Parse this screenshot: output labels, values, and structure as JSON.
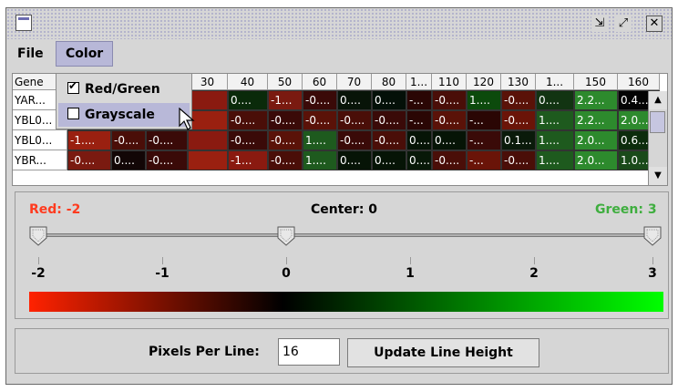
{
  "window": {
    "restore_icon": "restore-icon",
    "maximize_icon": "maximize-icon",
    "close_icon": "close-icon"
  },
  "menubar": {
    "file": "File",
    "color": "Color"
  },
  "color_menu": {
    "items": [
      {
        "label": "Red/Green",
        "checked": true
      },
      {
        "label": "Grayscale",
        "checked": false
      }
    ]
  },
  "table": {
    "first_header": "Gene",
    "columns": [
      "30",
      "40",
      "50",
      "60",
      "70",
      "80",
      "1...",
      "110",
      "120",
      "130",
      "1...",
      "150",
      "160"
    ],
    "rows": [
      {
        "label": "YAR...",
        "cells": [
          "",
          "0....",
          "-1...",
          "-0....",
          "0....",
          "0....",
          "-...",
          "-0....",
          "1....",
          "-0....",
          "0....",
          "2.2...",
          "0.4..."
        ],
        "colors": [
          "#8a1a10",
          "#0a2a0a",
          "#7a1a10",
          "#3a0a08",
          "#081408",
          "#041008",
          "#2a0604",
          "#4a0e08",
          "#0c4a0c",
          "#5a1208",
          "#123412",
          "#2d8a2d",
          "#040404"
        ]
      },
      {
        "label": "YBL0...",
        "cells": [
          "",
          "-0....",
          "-0....",
          "-0....",
          "-0....",
          "-0....",
          "-...",
          "-0....",
          "-...",
          "-0....",
          "1....",
          "2.2...",
          "2.0..."
        ],
        "colors": [
          "#9a2010",
          "#4a0e08",
          "#3a0a08",
          "#5a1208",
          "#4a0e08",
          "#3a0a08",
          "#2a0604",
          "#5a1208",
          "#2a0604",
          "#6a1408",
          "#1e5a1e",
          "#2d8a2d",
          "#2d8a2d"
        ]
      },
      {
        "label": "YBL0...",
        "cells": [
          "",
          "-0....",
          "-0....",
          "1....",
          "-0....",
          "-0....",
          "0....",
          "0....",
          "-...",
          "0.1...",
          "1....",
          "2.0...",
          "0.6..."
        ],
        "colors": [
          "#8a1a10",
          "#3a0a08",
          "#5a1208",
          "#1e5a1e",
          "#3a0a08",
          "#4a0e08",
          "#061406",
          "#061406",
          "#3a0a08",
          "#0a1a0a",
          "#1e5a1e",
          "#2d8a2d",
          "#0c2c0c"
        ]
      },
      {
        "label": "YBR...",
        "cells": [
          "",
          "-1...",
          "-0....",
          "1....",
          "0....",
          "0....",
          "0....",
          "-0....",
          "-...",
          "-0....",
          "1....",
          "2.0...",
          "1.0..."
        ],
        "colors": [
          "#9a2010",
          "#8a1a10",
          "#4a0e08",
          "#1e5a1e",
          "#061406",
          "#061406",
          "#081808",
          "#4a0e08",
          "#6a1408",
          "#4a0e08",
          "#1e5a1e",
          "#2d8a2d",
          "#1a4a1a"
        ]
      }
    ],
    "left_cells": [
      [
        "",
        "",
        ""
      ],
      [
        "",
        "",
        ""
      ],
      [
        "-1....",
        "-0....",
        "-0...."
      ],
      [
        "-0....",
        "0....",
        "-0...."
      ]
    ],
    "left_colors": [
      [
        "#8a1a10",
        "#8a1a10",
        "#8a1a10"
      ],
      [
        "#8a1a10",
        "#8a1a10",
        "#8a1a10"
      ],
      [
        "#9a2010",
        "#4a0e08",
        "#3a0a08"
      ],
      [
        "#7a1a10",
        "#120606",
        "#3a0a08"
      ]
    ]
  },
  "slider": {
    "red_label": "Red: -2",
    "center_label": "Center: 0",
    "green_label": "Green: 3",
    "ticks": [
      "-2",
      "-1",
      "0",
      "1",
      "2",
      "3"
    ],
    "red_color": "#ff3b1f",
    "green_color": "#3fae3f"
  },
  "bottom": {
    "pixels_label": "Pixels Per Line:",
    "pixels_value": "16",
    "update_button": "Update Line Height"
  }
}
